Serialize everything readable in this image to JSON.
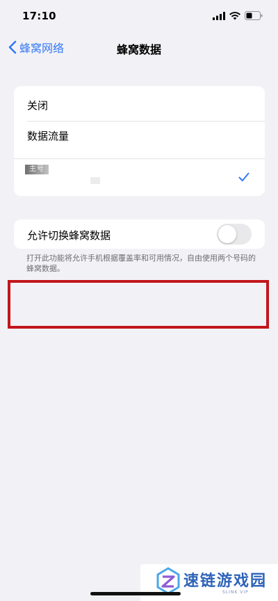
{
  "status_bar": {
    "time": "17:10",
    "icons": [
      "signal-icon",
      "wifi-icon",
      "battery-icon"
    ]
  },
  "nav": {
    "back_label": "蜂窝网络",
    "title": "蜂窝数据"
  },
  "options": {
    "items": [
      {
        "label": "关闭"
      },
      {
        "label": "数据流量"
      },
      {
        "label": "主号",
        "selected": true
      }
    ]
  },
  "toggle": {
    "label": "允许切换蜂窝数据",
    "enabled": false
  },
  "footer_note": "打开此功能将允许手机根据覆盖率和可用情况，自由使用两个号码的蜂窝数据。",
  "watermark": {
    "title": "速链游戏园",
    "subtitle": "SLINK VIP"
  },
  "colors": {
    "accent": "#3478f6",
    "background": "#f2f2f6",
    "highlight": "#c2161b"
  }
}
